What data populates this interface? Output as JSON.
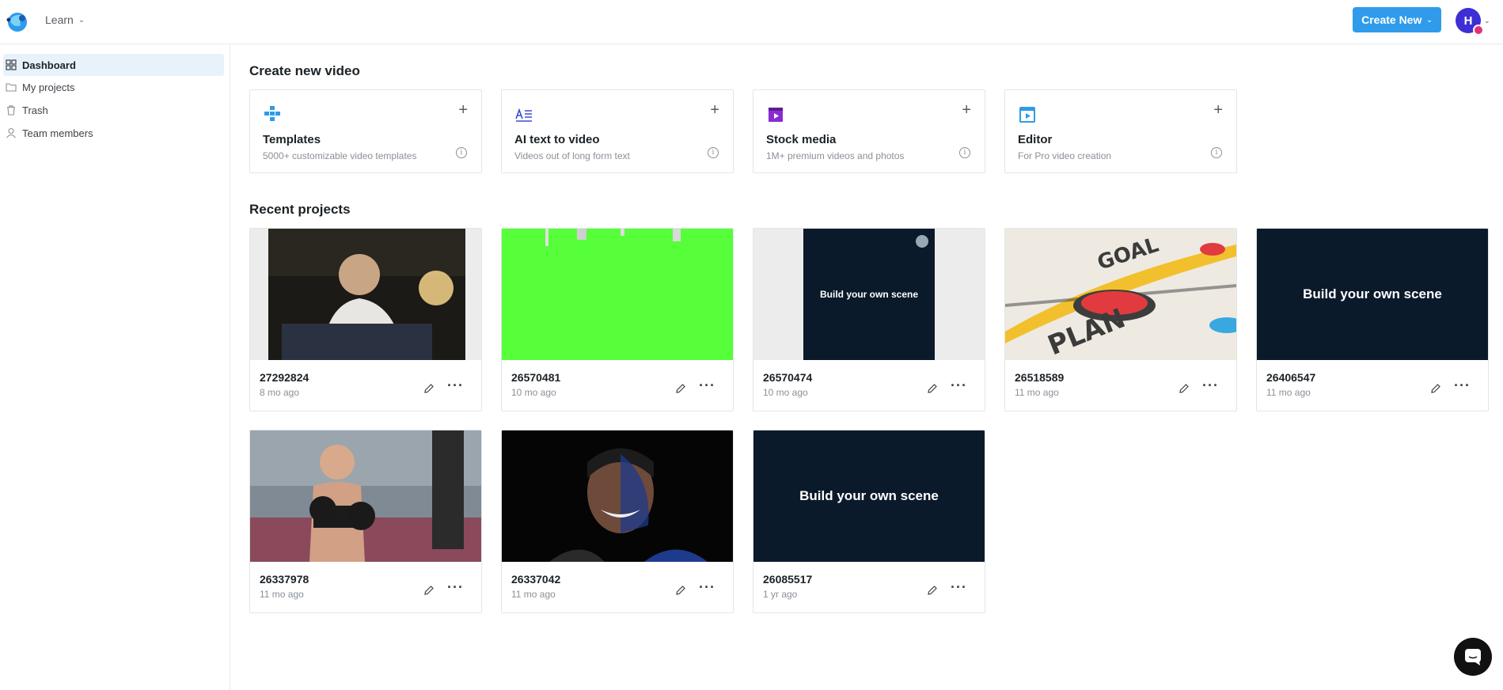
{
  "header": {
    "learn_label": "Learn",
    "create_button": "Create New",
    "avatar_initial": "H"
  },
  "sidebar": {
    "items": [
      {
        "label": "Dashboard",
        "icon": "grid-icon",
        "active": true
      },
      {
        "label": "My projects",
        "icon": "folder-icon",
        "active": false
      },
      {
        "label": "Trash",
        "icon": "trash-icon",
        "active": false
      },
      {
        "label": "Team members",
        "icon": "user-icon",
        "active": false
      }
    ]
  },
  "create": {
    "heading": "Create new video",
    "cards": [
      {
        "title": "Templates",
        "subtitle": "5000+ customizable video templates",
        "icon": "templates-icon",
        "color": "#2f9bea"
      },
      {
        "title": "AI text to video",
        "subtitle": "Videos out of long form text",
        "icon": "ai-text-icon",
        "color": "#3d4bd6"
      },
      {
        "title": "Stock media",
        "subtitle": "1M+ premium videos and photos",
        "icon": "stock-media-icon",
        "color": "#8a2bd1"
      },
      {
        "title": "Editor",
        "subtitle": "For Pro video creation",
        "icon": "editor-icon",
        "color": "#2f9bea"
      }
    ]
  },
  "recent": {
    "heading": "Recent projects",
    "projects": [
      {
        "id": "27292824",
        "age": "8 mo ago",
        "thumb": "man-at-desk"
      },
      {
        "id": "26570481",
        "age": "10 mo ago",
        "thumb": "green-screen"
      },
      {
        "id": "26570474",
        "age": "10 mo ago",
        "thumb": "build-scene-vertical",
        "thumb_text": "Build your own scene"
      },
      {
        "id": "26518589",
        "age": "11 mo ago",
        "thumb": "goal-plan-map",
        "thumb_text_1": "GOAL",
        "thumb_text_2": "PLAN"
      },
      {
        "id": "26406547",
        "age": "11 mo ago",
        "thumb": "build-scene",
        "thumb_text": "Build your own scene"
      },
      {
        "id": "26337978",
        "age": "11 mo ago",
        "thumb": "boxer"
      },
      {
        "id": "26337042",
        "age": "11 mo ago",
        "thumb": "smiling-man-dark"
      },
      {
        "id": "26085517",
        "age": "1 yr ago",
        "thumb": "build-scene",
        "thumb_text": "Build your own scene"
      }
    ]
  },
  "colors": {
    "accent": "#2f9bea",
    "avatar": "#3d2fd3",
    "scene_bg": "#0b1a2b",
    "green_screen": "#56ff3a"
  }
}
